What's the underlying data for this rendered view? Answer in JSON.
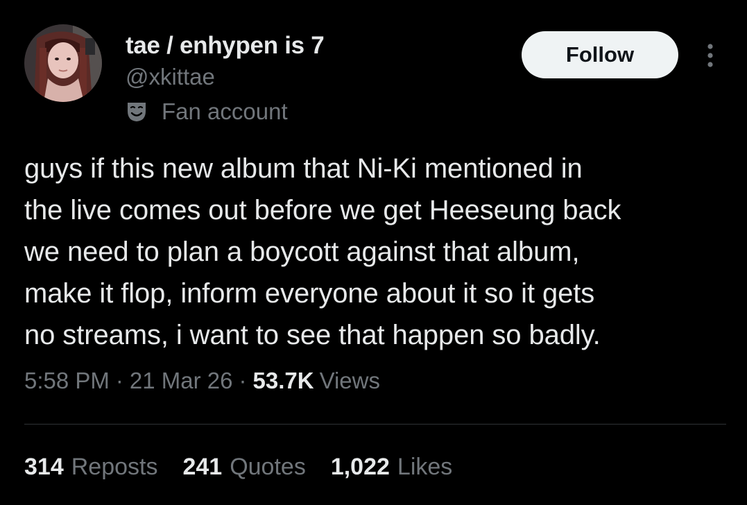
{
  "theme": {
    "background": "#000000",
    "text_primary": "#e7e9ea",
    "text_secondary": "#71767b",
    "follow_button_bg": "#eff3f4",
    "divider": "#2f3336"
  },
  "author": {
    "display_name": "tae / enhypen is 7",
    "handle": "@xkittae",
    "label_icon": "theater-mask-icon",
    "label": "Fan account",
    "avatar_icon": "user-avatar"
  },
  "actions": {
    "follow_label": "Follow",
    "more_icon": "more-vertical-icon"
  },
  "tweet": {
    "text": "guys if this new album that Ni-Ki mentioned in\nthe live comes out before we get Heeseung back\nwe need to plan a boycott against that album,\nmake it flop, inform everyone about it so it gets\nno streams, i want to see that happen so badly.",
    "time": "5:58 PM",
    "date": "21 Mar 26",
    "separator": "·",
    "views_count": "53.7K",
    "views_label": "Views"
  },
  "stats": {
    "reposts_count": "314",
    "reposts_label": "Reposts",
    "quotes_count": "241",
    "quotes_label": "Quotes",
    "likes_count": "1,022",
    "likes_label": "Likes"
  }
}
